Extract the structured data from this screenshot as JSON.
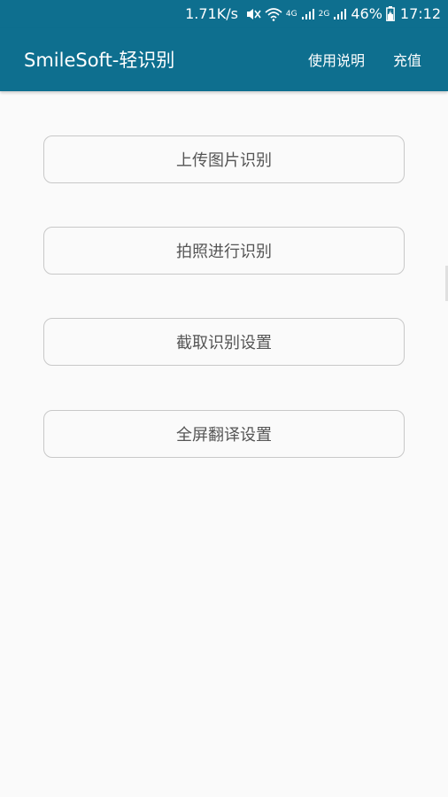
{
  "status_bar": {
    "speed": "1.71K/s",
    "network_4g": "4G",
    "network_2g": "2G",
    "battery": "46%",
    "time": "17:12",
    "icons": [
      "mute-icon",
      "wifi-icon",
      "signal-icon",
      "signal-icon",
      "battery-charging-icon"
    ]
  },
  "app_bar": {
    "title": "SmileSoft-轻识别",
    "actions": [
      "使用说明",
      "充值"
    ]
  },
  "main": {
    "buttons": [
      "上传图片识别",
      "拍照进行识别",
      "截取识别设置",
      "全屏翻译设置"
    ]
  },
  "colors": {
    "primary": "#0e6f8f",
    "background": "#fafafa",
    "button_border": "#c8c8c8",
    "button_text": "#555555"
  }
}
